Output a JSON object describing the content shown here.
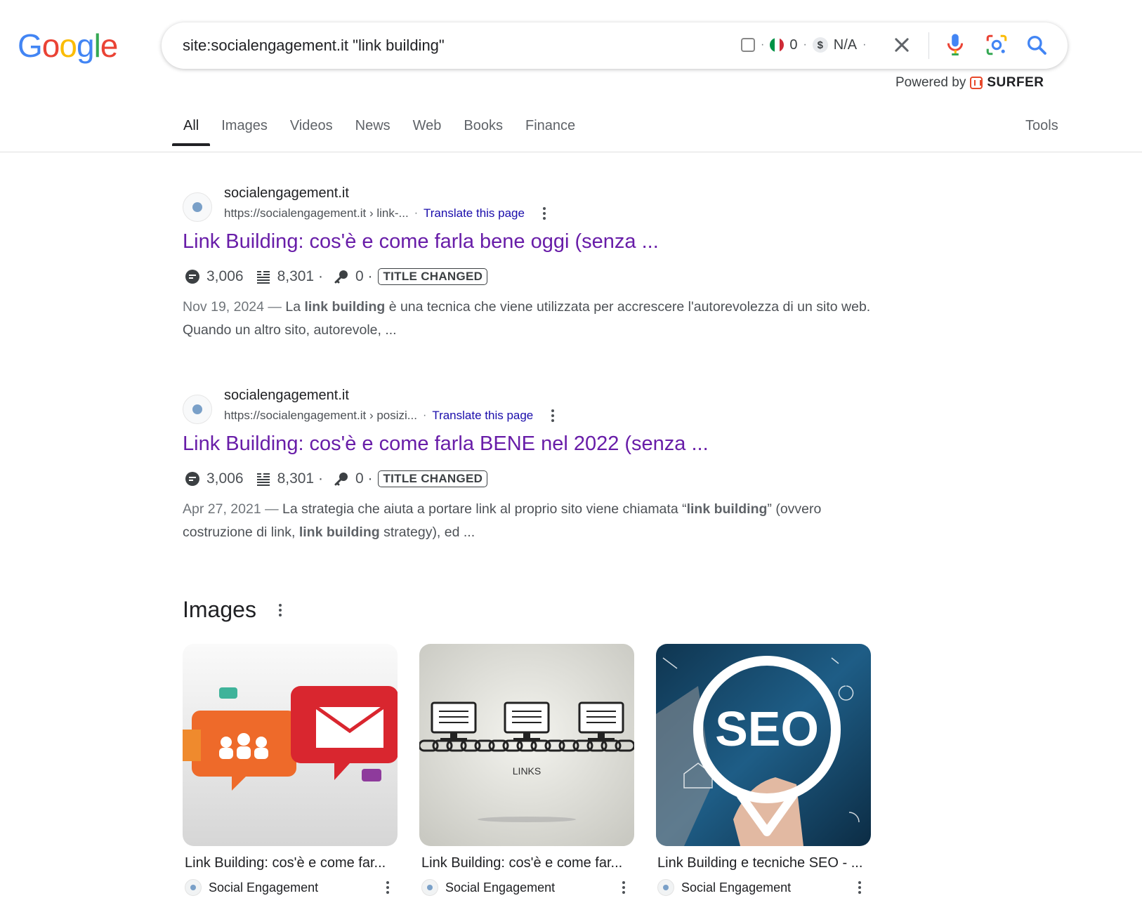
{
  "logo": {
    "letters": [
      "G",
      "o",
      "o",
      "g",
      "l",
      "e"
    ],
    "colors": [
      "#4285F4",
      "#EA4335",
      "#FBBC05",
      "#4285F4",
      "#34A853",
      "#EA4335"
    ]
  },
  "search": {
    "query": "site:socialengagement.it \"link building\"",
    "ext_count": "0",
    "ext_value": "N/A",
    "dollar_symbol": "$"
  },
  "powered": {
    "label": "Powered by",
    "brand": "SURFER"
  },
  "tabs": [
    {
      "label": "All",
      "active": true
    },
    {
      "label": "Images"
    },
    {
      "label": "Videos"
    },
    {
      "label": "News"
    },
    {
      "label": "Web"
    },
    {
      "label": "Books"
    },
    {
      "label": "Finance"
    }
  ],
  "tools_label": "Tools",
  "results": [
    {
      "site": "socialengagement.it",
      "url": "https://socialengagement.it › link-...",
      "translate": "Translate this page",
      "title": "Link Building: cos'è e come farla bene oggi (senza ...",
      "metric1": "3,006",
      "metric2": "8,301 ·",
      "metric3": "0 ·",
      "badge": "TITLE CHANGED",
      "snippet": [
        {
          "t": "Nov 19, 2024 — ",
          "date": true
        },
        {
          "t": "La "
        },
        {
          "t": "link building",
          "b": true
        },
        {
          "t": " è una tecnica che viene utilizzata per accrescere l'autorevolezza di un sito web. Quando un altro sito, autorevole, ..."
        }
      ]
    },
    {
      "site": "socialengagement.it",
      "url": "https://socialengagement.it › posizi...",
      "translate": "Translate this page",
      "title": "Link Building: cos'è e come farla BENE nel 2022 (senza ...",
      "metric1": "3,006",
      "metric2": "8,301 ·",
      "metric3": "0 ·",
      "badge": "TITLE CHANGED",
      "snippet": [
        {
          "t": "Apr 27, 2021 — ",
          "date": true
        },
        {
          "t": "La strategia che aiuta a portare link al proprio sito viene chiamata “"
        },
        {
          "t": "link building",
          "b": true
        },
        {
          "t": "” (ovvero costruzione di link, "
        },
        {
          "t": "link building",
          "b": true
        },
        {
          "t": " strategy), ed ..."
        }
      ]
    }
  ],
  "images_section": {
    "heading": "Images",
    "items": [
      {
        "caption": "Link Building: cos'è e come far...",
        "source": "Social Engagement"
      },
      {
        "caption": "Link Building: cos'è e come far...",
        "source": "Social Engagement",
        "inner_text": "LINKS"
      },
      {
        "caption": "Link Building e tecniche SEO - ...",
        "source": "Social Engagement",
        "inner_text": "SEO"
      }
    ]
  },
  "colors": {
    "title_visited": "#681da8",
    "link": "#1a0dab",
    "text_secondary": "#4d5156"
  }
}
